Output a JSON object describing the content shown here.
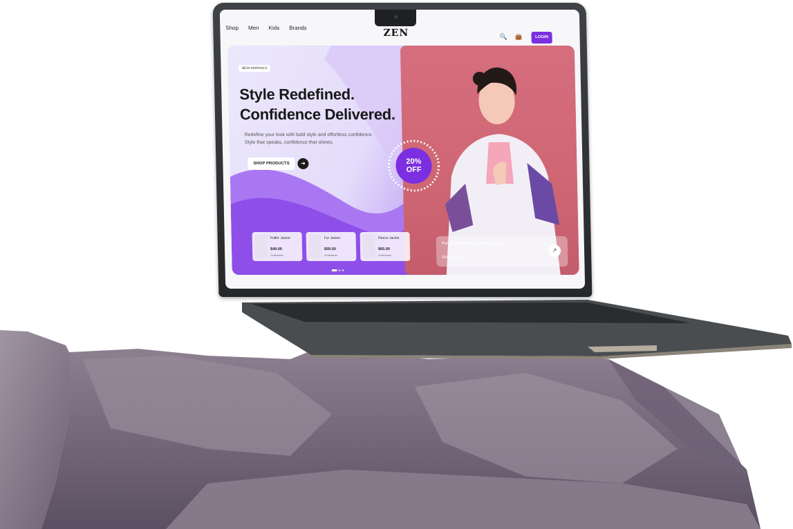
{
  "nav": {
    "links": [
      "Shop",
      "Men",
      "Kids",
      "Brands"
    ],
    "logo": "ZEN",
    "login_label": "LOGIN"
  },
  "hero": {
    "tag": "NEW ARRIVALS",
    "headline_line1": "Style Redefined.",
    "headline_line2": "Confidence Delivered.",
    "description_line1": "Redefine your look with bold style and effortless confidence.",
    "description_line2": "Style that speaks, confidence that shines.",
    "shop_button": "SHOP PRODUCTS",
    "arrow": "➜",
    "badge_line1": "20%",
    "badge_line2": "OFF"
  },
  "products": [
    {
      "name": "Puffer Jacket",
      "price": "$49.00",
      "sub": "Outerwear"
    },
    {
      "name": "Fur Jacket",
      "price": "$59.00",
      "sub": "Outerwear"
    },
    {
      "name": "Fleece Jacket",
      "price": "$65.00",
      "sub": "Outerwear"
    }
  ],
  "promo": {
    "title": "Purple and Premium Soft Jacket",
    "sub": "20% Discount!",
    "button": "↗"
  },
  "icons": {
    "search": "🔍",
    "cart": "👜"
  },
  "colors": {
    "accent": "#7a2fe0",
    "hero_photo_bg": "#d56e7d"
  }
}
